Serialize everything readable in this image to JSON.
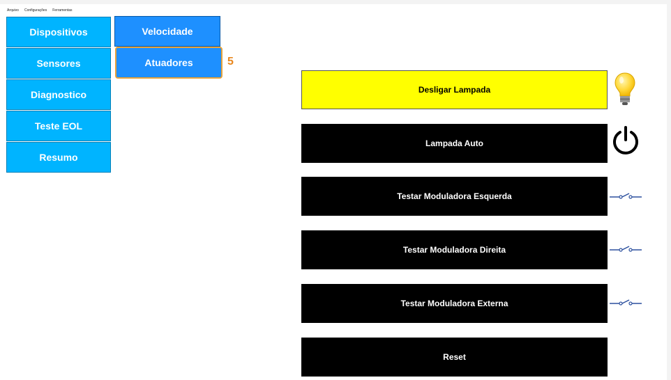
{
  "menu": [
    "Arquivo",
    "Configurações",
    "Ferramentas"
  ],
  "nav": {
    "primary": [
      "Dispositivos",
      "Sensores",
      "Diagnostico",
      "Teste EOL",
      "Resumo"
    ],
    "secondary": [
      "Velocidade",
      "Atuadores"
    ],
    "selected": "Atuadores",
    "step_badge": "5"
  },
  "actions": [
    {
      "label": "Desligar Lampada",
      "state": "on",
      "icon": "lightbulb-icon"
    },
    {
      "label": "Lampada Auto",
      "state": "off",
      "icon": "power-icon"
    },
    {
      "label": "Testar Moduladora Esquerda",
      "state": "off",
      "icon": "switch-icon"
    },
    {
      "label": "Testar Moduladora Direita",
      "state": "off",
      "icon": "switch-icon"
    },
    {
      "label": "Testar Moduladora Externa",
      "state": "off",
      "icon": "switch-icon"
    },
    {
      "label": "Reset",
      "state": "off",
      "icon": ""
    }
  ],
  "colors": {
    "nav_primary": "#00b4ff",
    "nav_secondary": "#1e90ff",
    "action_off": "#000000",
    "action_on": "#ffff00",
    "badge": "#e8871e",
    "switch_icon": "#2b4f9e"
  }
}
